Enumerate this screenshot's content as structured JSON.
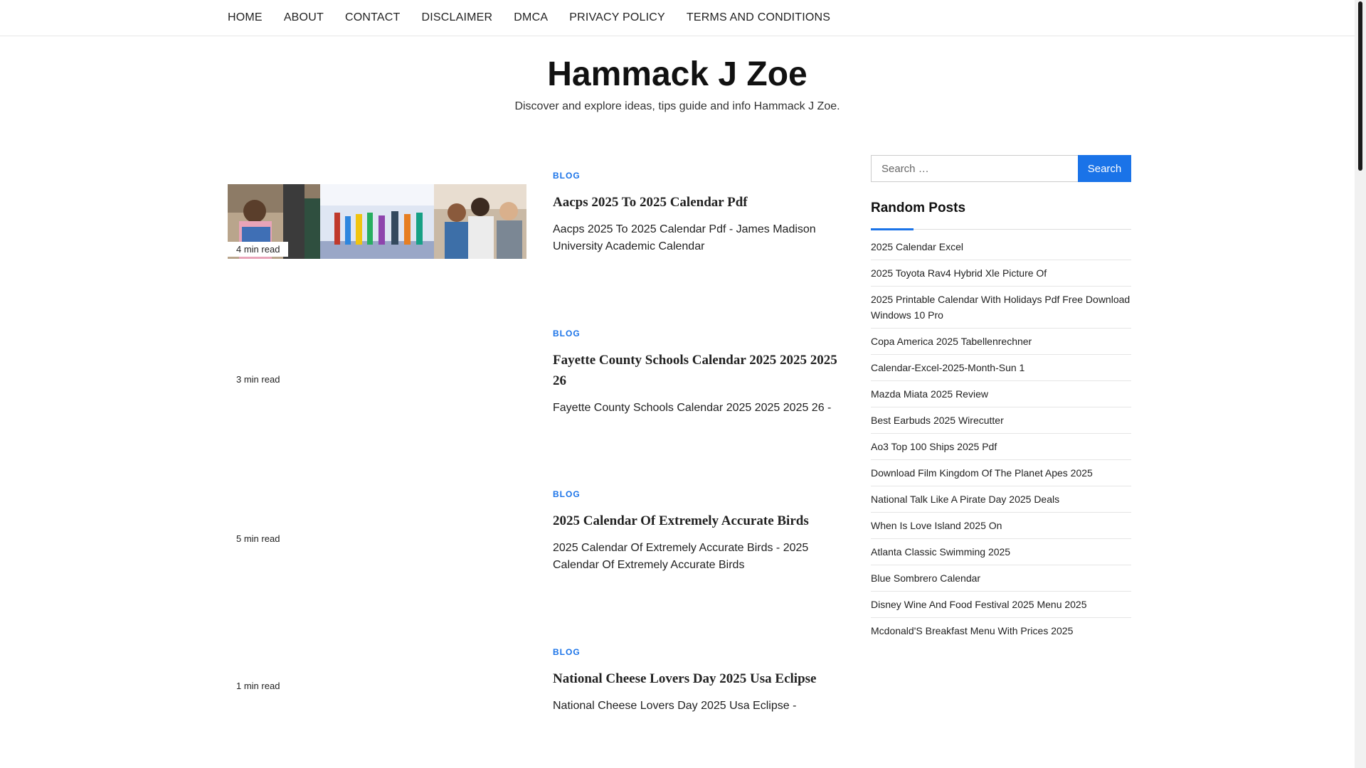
{
  "nav": {
    "items": [
      "HOME",
      "ABOUT",
      "CONTACT",
      "DISCLAIMER",
      "DMCA",
      "PRIVACY POLICY",
      "TERMS AND CONDITIONS"
    ]
  },
  "header": {
    "title": "Hammack J Zoe",
    "description": "Discover and explore ideas, tips guide and info Hammack J Zoe."
  },
  "posts": [
    {
      "category": "BLOG",
      "title": "Aacps 2025 To 2025 Calendar Pdf",
      "excerpt": "Aacps 2025 To 2025 Calendar Pdf - James Madison University Academic Calendar",
      "read_time": "4 min read",
      "has_image": true
    },
    {
      "category": "BLOG",
      "title": "Fayette County Schools Calendar 2025 2025 2025 26",
      "excerpt": "Fayette County Schools Calendar 2025 2025 2025 26 -",
      "read_time": "3 min read",
      "has_image": false
    },
    {
      "category": "BLOG",
      "title": "2025 Calendar Of Extremely Accurate Birds",
      "excerpt": "2025 Calendar Of Extremely Accurate Birds - 2025 Calendar Of Extremely Accurate Birds",
      "read_time": "5 min read",
      "has_image": false
    },
    {
      "category": "BLOG",
      "title": "National Cheese Lovers Day 2025 Usa Eclipse",
      "excerpt": "National Cheese Lovers Day 2025 Usa Eclipse -",
      "read_time": "1 min read",
      "has_image": false
    }
  ],
  "sidebar": {
    "search": {
      "placeholder": "Search …",
      "button_label": "Search"
    },
    "random_posts": {
      "title": "Random Posts",
      "items": [
        "2025 Calendar Excel",
        "2025 Toyota Rav4 Hybrid Xle Picture Of",
        "2025 Printable Calendar With Holidays Pdf Free Download Windows 10 Pro",
        "Copa America 2025 Tabellenrechner",
        "Calendar-Excel-2025-Month-Sun 1",
        "Mazda Miata 2025 Review",
        "Best Earbuds 2025 Wirecutter",
        "Ao3 Top 100 Ships 2025 Pdf",
        "Download Film Kingdom Of The Planet Apes 2025",
        "National Talk Like A Pirate Day 2025 Deals",
        "When Is Love Island 2025 On",
        "Atlanta Classic Swimming 2025",
        "Blue Sombrero Calendar",
        "Disney Wine And Food Festival 2025 Menu 2025",
        "Mcdonald'S Breakfast Menu With Prices 2025"
      ]
    }
  },
  "colors": {
    "accent": "#1a73e8",
    "text": "#222222"
  }
}
